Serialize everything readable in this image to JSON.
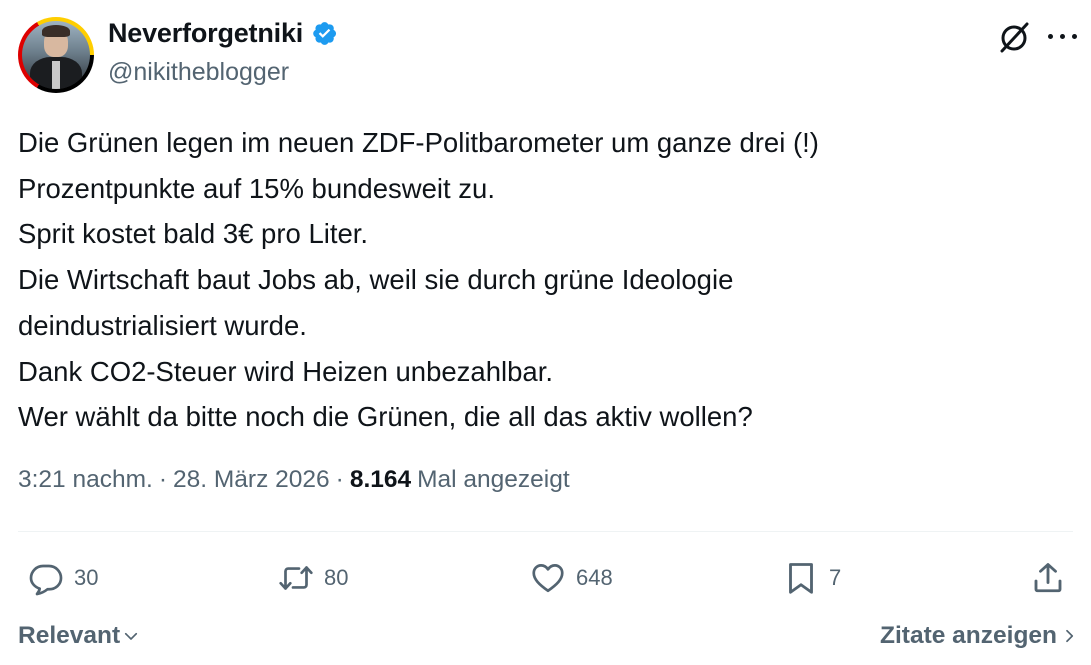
{
  "author": {
    "display_name": "Neverforgetniki",
    "handle": "@nikitheblogger",
    "verified": true,
    "avatar_ring_colors": [
      "#000000",
      "#dd0000",
      "#ffce00"
    ]
  },
  "header_icons": [
    "grok-icon",
    "more-icon"
  ],
  "tweet": {
    "lines": [
      "Die Grünen legen im neuen ZDF-Politbarometer um ganze drei (!)",
      "Prozentpunkte auf 15% bundesweit zu.",
      "Sprit kostet bald 3€ pro Liter.",
      "Die Wirtschaft baut Jobs ab, weil sie durch grüne Ideologie",
      "deindustrialisiert wurde.",
      "Dank CO2-Steuer wird Heizen unbezahlbar.",
      "Wer wählt da bitte noch die Grünen, die all das aktiv wollen?"
    ]
  },
  "meta": {
    "time": "3:21 nachm.",
    "separator": "·",
    "date": "28. März 2026",
    "views_count": "8.164",
    "views_label": "Mal angezeigt"
  },
  "actions": {
    "replies": "30",
    "retweets": "80",
    "likes": "648",
    "bookmarks": "7"
  },
  "footer": {
    "sort_label": "Relevant",
    "quotes_label": "Zitate anzeigen"
  },
  "colors": {
    "text": "#0f1419",
    "secondary": "#536471",
    "verified": "#1d9bf0",
    "divider": "#eff3f4"
  }
}
